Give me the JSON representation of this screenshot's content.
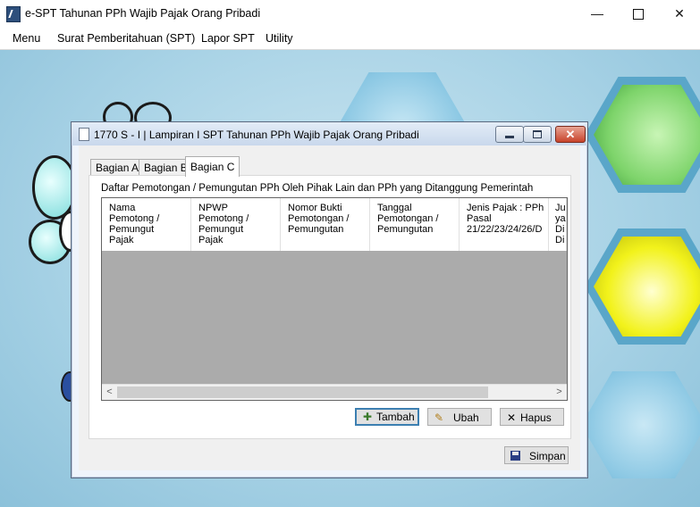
{
  "app": {
    "title": "e-SPT Tahunan PPh Wajib Pajak Orang Pribadi",
    "window_controls": {
      "minimize": "—",
      "close": "✕"
    }
  },
  "menu": [
    "Menu",
    "Surat Pemberitahuan (SPT)",
    "Lapor SPT",
    "Utility"
  ],
  "dialog": {
    "title": "1770 S - I | Lampiran I SPT Tahunan PPh Wajib Pajak Orang Pribadi",
    "close_glyph": "✕",
    "tabs": [
      {
        "label": "Bagian A",
        "active": false
      },
      {
        "label": "Bagian B",
        "active": false
      },
      {
        "label": "Bagian C",
        "active": true
      }
    ],
    "section_caption": "Daftar Pemotongan / Pemungutan PPh Oleh Pihak Lain dan PPh yang Ditanggung Pemerintah",
    "table": {
      "columns": [
        "Nama\nPemotong /\nPemungut\nPajak",
        "NPWP\nPemotong /\nPemungut\nPajak",
        "Nomor Bukti\nPemotongan /\nPemungutan",
        "Tanggal\nPemotongan /\nPemungutan",
        "Jenis Pajak : PPh\nPasal\n21/22/23/24/26/D",
        "Ju\nya\nDi\nDi"
      ],
      "rows": [],
      "scroll_left": "<",
      "scroll_right": ">"
    },
    "buttons": {
      "tambah": "Tambah",
      "ubah": "Ubah",
      "hapus": "Hapus",
      "simpan": "Simpan"
    }
  }
}
